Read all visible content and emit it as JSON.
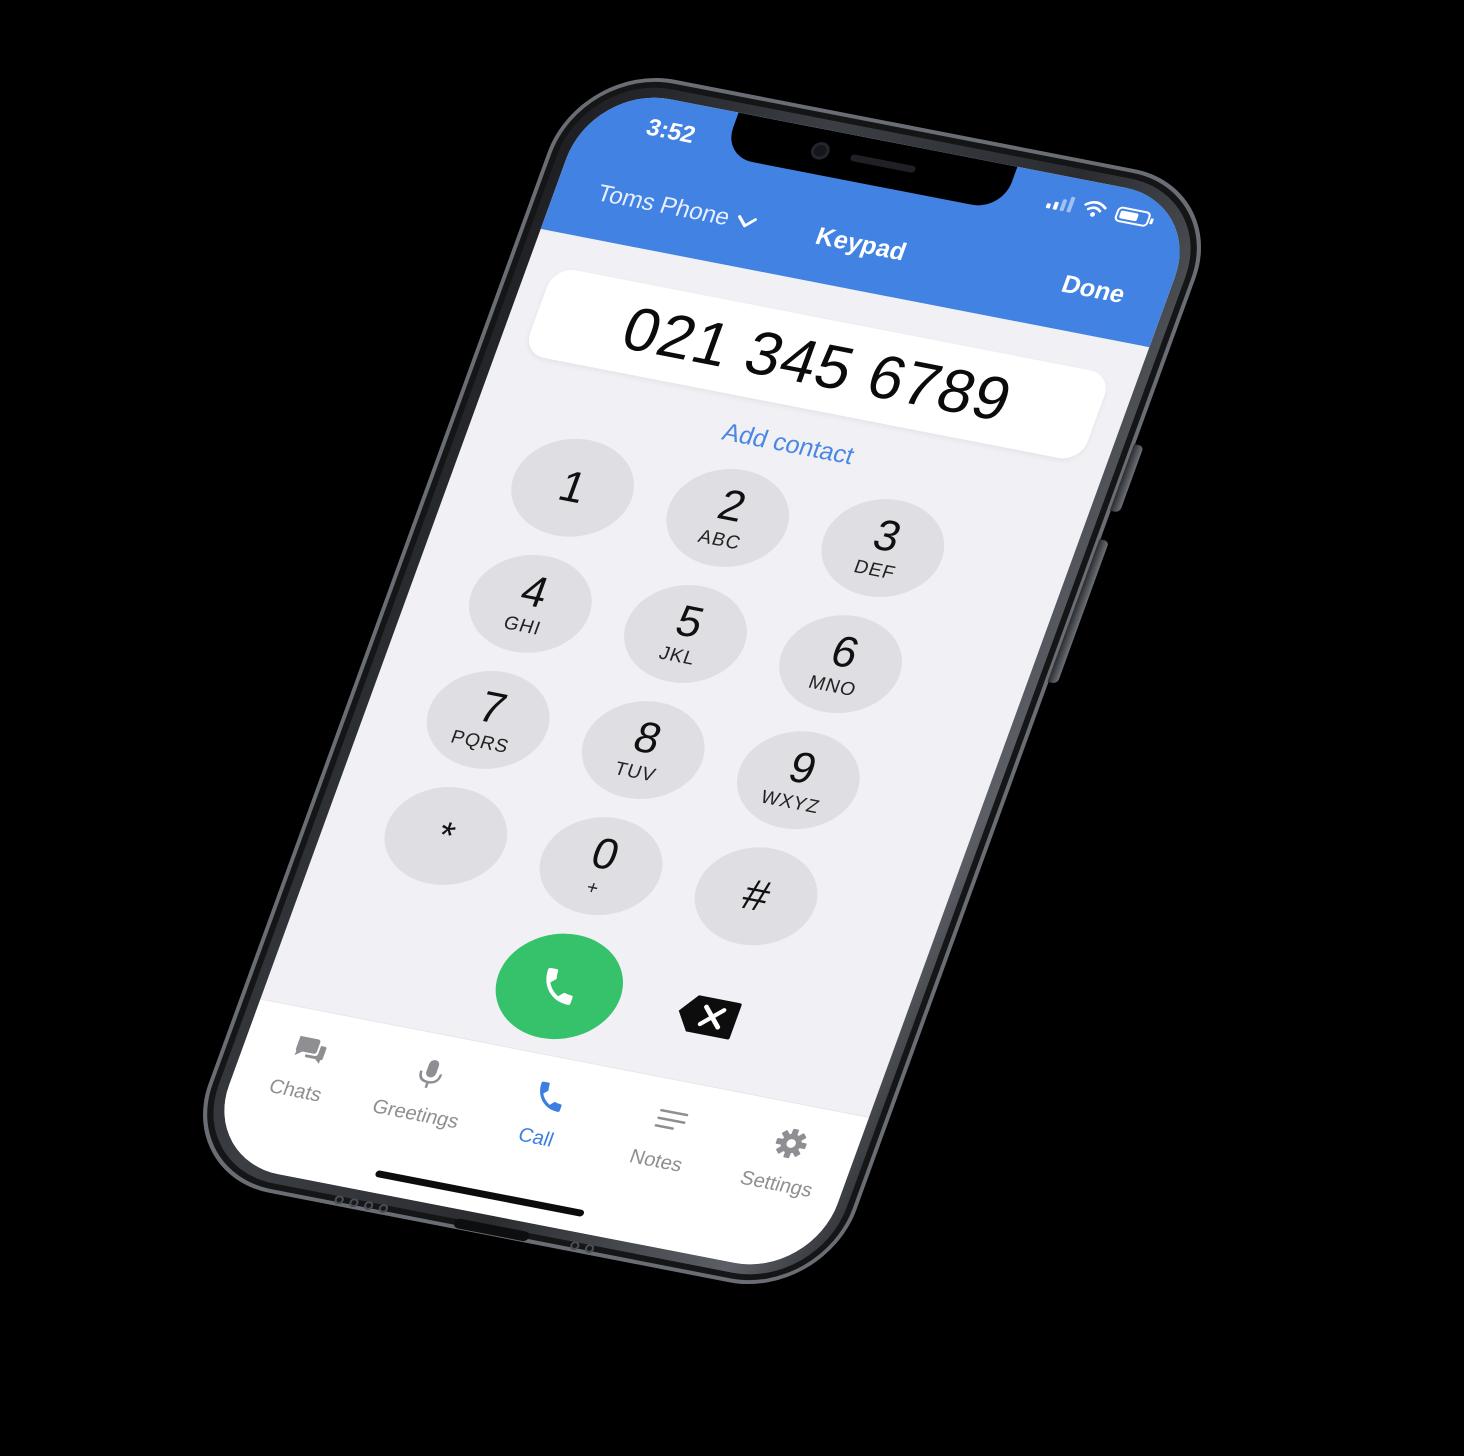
{
  "status_bar": {
    "time": "3:52",
    "battery_level": 0.7,
    "icons": [
      "signal-icon",
      "wifi-icon",
      "battery-icon"
    ]
  },
  "nav_bar": {
    "account_label": "Toms Phone",
    "title": "Keypad",
    "done_label": "Done"
  },
  "dialer": {
    "number": "021 345 6789",
    "add_contact_label": "Add contact"
  },
  "keypad": {
    "keys": [
      {
        "digit": "1",
        "letters": ""
      },
      {
        "digit": "2",
        "letters": "ABC"
      },
      {
        "digit": "3",
        "letters": "DEF"
      },
      {
        "digit": "4",
        "letters": "GHI"
      },
      {
        "digit": "5",
        "letters": "JKL"
      },
      {
        "digit": "6",
        "letters": "MNO"
      },
      {
        "digit": "7",
        "letters": "PQRS"
      },
      {
        "digit": "8",
        "letters": "TUV"
      },
      {
        "digit": "9",
        "letters": "WXYZ"
      },
      {
        "digit": "*",
        "letters": ""
      },
      {
        "digit": "0",
        "letters": "+"
      },
      {
        "digit": "#",
        "letters": ""
      }
    ]
  },
  "actions": {
    "call_icon": "phone-icon",
    "backspace_icon": "backspace-icon"
  },
  "tab_bar": {
    "items": [
      {
        "label": "Chats",
        "icon": "chat-bubbles-icon",
        "active": false
      },
      {
        "label": "Greetings",
        "icon": "microphone-icon",
        "active": false
      },
      {
        "label": "Call",
        "icon": "phone-icon",
        "active": true
      },
      {
        "label": "Notes",
        "icon": "lines-icon",
        "active": false
      },
      {
        "label": "Settings",
        "icon": "gear-icon",
        "active": false
      }
    ]
  },
  "colors": {
    "header_blue": "#4282e3",
    "accent_blue": "#3d7fe0",
    "call_green": "#35c26b",
    "key_gray": "#dedee3",
    "screen_bg": "#f1f1f5",
    "inactive_gray": "#8e8e93"
  }
}
